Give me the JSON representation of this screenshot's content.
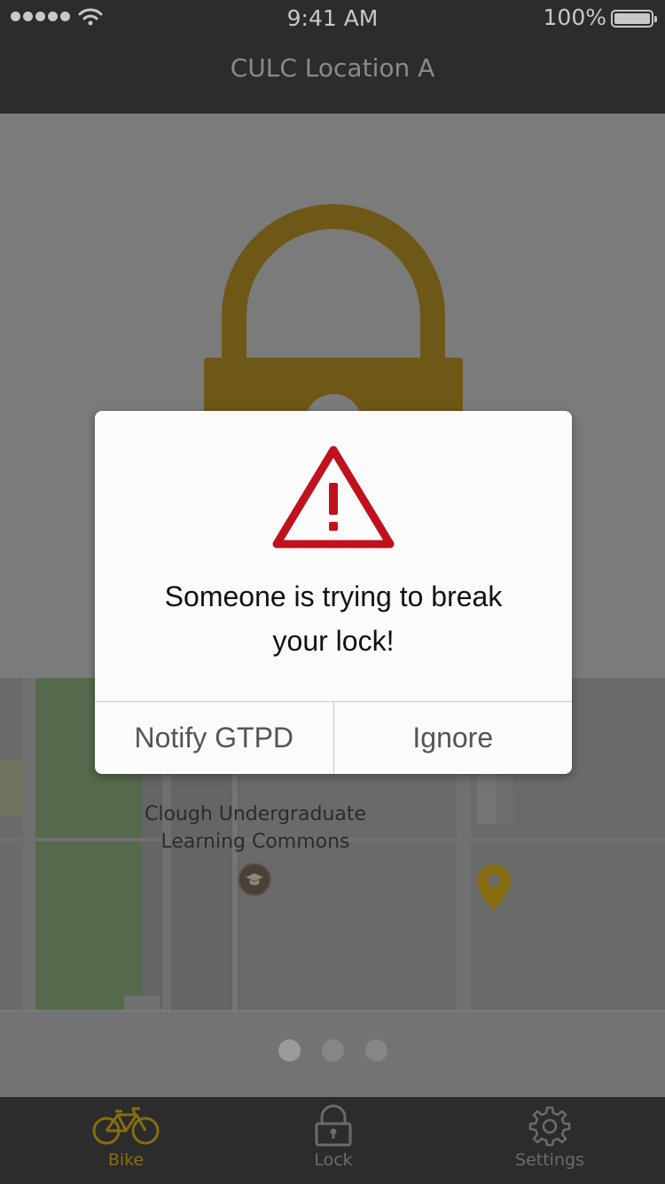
{
  "status_bar": {
    "time": "9:41 AM",
    "battery": "100%"
  },
  "nav": {
    "title": "CULC Location A"
  },
  "map": {
    "place_label_line1": "Clough Undergraduate",
    "place_label_line2": "Learning Commons"
  },
  "pager": {
    "page_count": 3,
    "current_page": 1
  },
  "alert": {
    "message_line1": "Someone is trying to break",
    "message_line2": "your lock!",
    "primary_action": "Notify GTPD",
    "secondary_action": "Ignore"
  },
  "tabs": [
    {
      "label": "Bike",
      "icon": "bicycle-icon",
      "selected": true
    },
    {
      "label": "Lock",
      "icon": "lock-icon",
      "selected": false
    },
    {
      "label": "Settings",
      "icon": "gear-icon",
      "selected": false
    }
  ],
  "colors": {
    "accent": "#866d10",
    "lock_gold": "#6e5818",
    "alert_red": "#c0121c",
    "bar_bg": "#2c2c2c"
  }
}
